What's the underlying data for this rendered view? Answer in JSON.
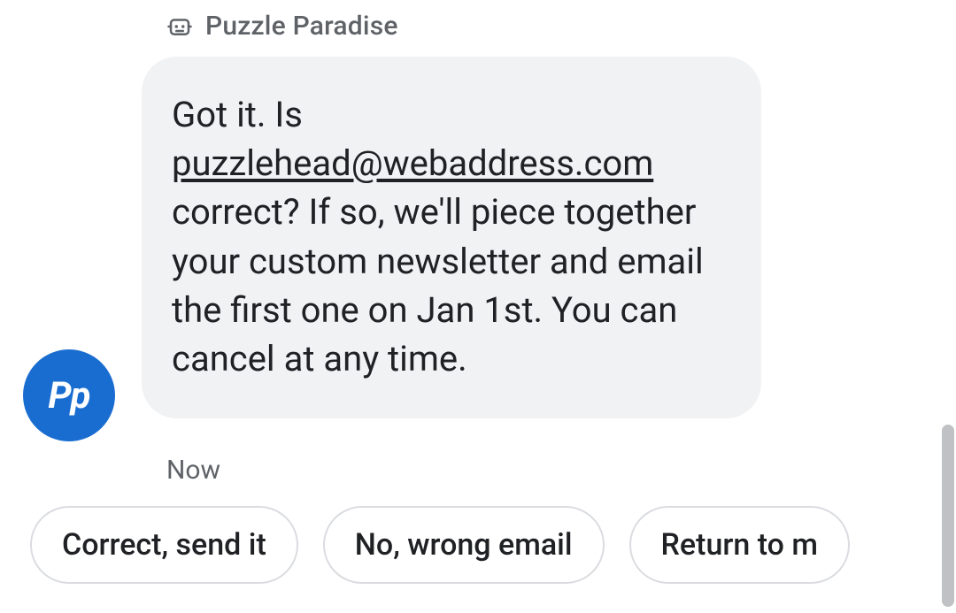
{
  "sender": {
    "name": "Puzzle Paradise",
    "avatar_initials": "Pp"
  },
  "message": {
    "text_before": "Got it. Is ",
    "email": "puzzlehead@webaddress.com",
    "text_after": " correct? If so, we'll piece together your custom newsletter and email the first one on Jan 1st. You can cancel at any time.",
    "timestamp": "Now"
  },
  "quick_replies": [
    "Correct, send it",
    "No, wrong email",
    "Return to m"
  ]
}
